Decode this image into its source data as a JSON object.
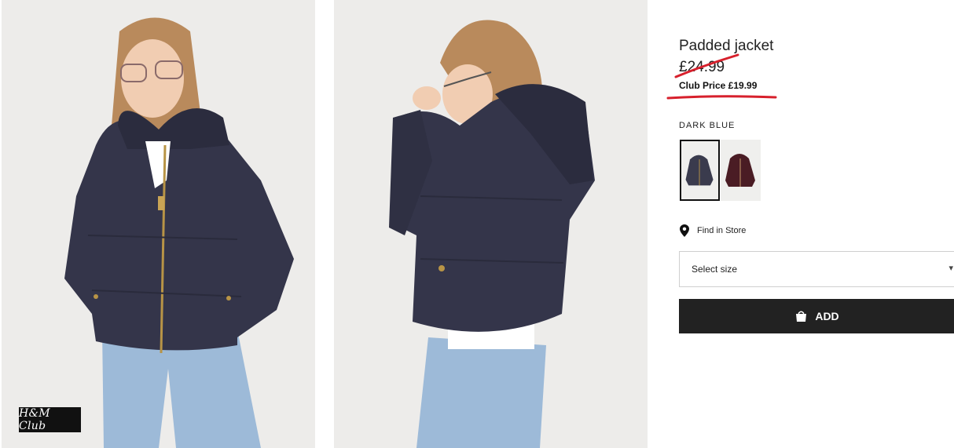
{
  "product": {
    "title": "Padded jacket",
    "old_price": "£24.99",
    "club_price": "Club Price £19.99",
    "color_name": "DARK BLUE",
    "swatches": [
      {
        "color": "#3a3b4d",
        "name": "Dark blue"
      },
      {
        "color": "#4a1c24",
        "name": "Burgundy"
      }
    ],
    "find_in_store": "Find in Store",
    "size_placeholder": "Select size",
    "add_label": "ADD"
  },
  "badge": {
    "text": "H&M Club"
  },
  "colors": {
    "accent_red": "#d7202c",
    "button_bg": "#222222",
    "jacket": "#34354a",
    "jeans": "#9dbad8"
  }
}
